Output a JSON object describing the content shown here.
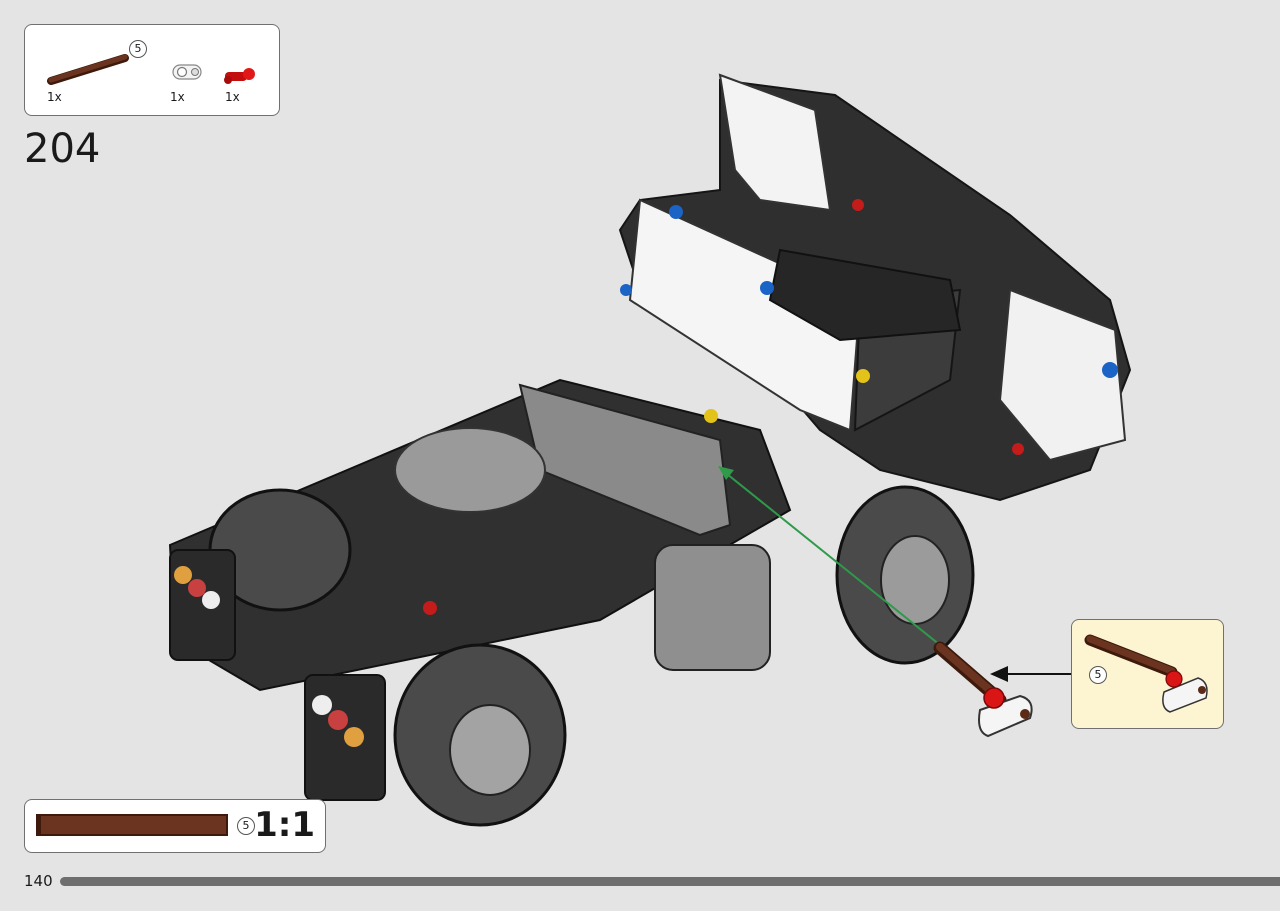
{
  "step": {
    "number": "204"
  },
  "parts_list": {
    "items": [
      {
        "name": "axle-length-5",
        "color": "#5a2b17",
        "quantity": "1x",
        "length": "5"
      },
      {
        "name": "axle-connector-white",
        "color": "#f2f2f2",
        "quantity": "1x"
      },
      {
        "name": "pin-red",
        "color": "#d01010",
        "quantity": "1x"
      }
    ]
  },
  "callout": {
    "length": "5"
  },
  "ruler": {
    "length": "5",
    "scale": "1:1",
    "color": "#5a2b17"
  },
  "page": {
    "number": "140"
  },
  "colors": {
    "background": "#e4e4e4",
    "callout_bg": "#fdf5d2",
    "arrow": "#2e9a4a"
  }
}
